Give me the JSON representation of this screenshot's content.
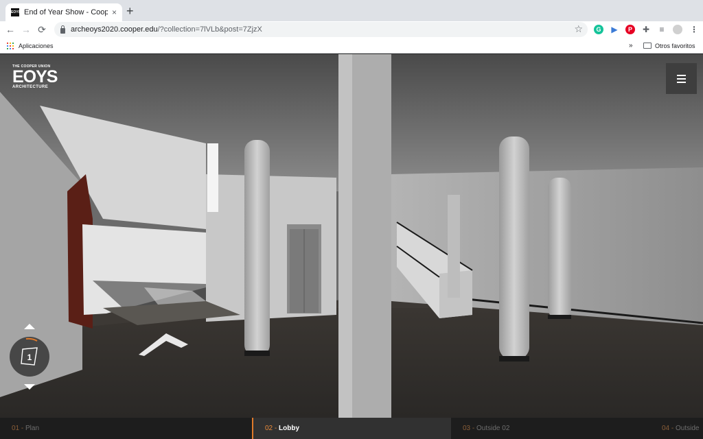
{
  "browser": {
    "tab": {
      "favicon_text": "EOYS",
      "title": "End of Year Show - Cooper Union",
      "close": "×"
    },
    "new_tab": "+",
    "nav": {
      "back": "←",
      "forward": "→",
      "reload": "⟳"
    },
    "url": {
      "host": "archeoys2020.cooper.edu",
      "path": "/?collection=7lVLb&post=7ZjzX"
    },
    "star": "☆",
    "extensions": [
      {
        "name": "grammarly-icon",
        "letter": "G",
        "color": "#15c39a"
      },
      {
        "name": "extension-flag-icon",
        "letter": "▶",
        "color": "#3b7bd6"
      },
      {
        "name": "pinterest-icon",
        "letter": "P",
        "color": "#e60023"
      },
      {
        "name": "puzzle-icon",
        "letter": "✚",
        "color": "#5f6368"
      },
      {
        "name": "media-queue-icon",
        "letter": "≡",
        "color": "#5f6368"
      },
      {
        "name": "profile-avatar-icon",
        "letter": "",
        "color": "#d0d0d0"
      },
      {
        "name": "more-menu-icon",
        "letter": "⋮",
        "color": "#5f6368"
      }
    ],
    "bookmarks": {
      "apps_label": "Aplicaciones",
      "overflow": "»",
      "other_label": "Otros favoritos"
    }
  },
  "site": {
    "logo": {
      "top": "THE COOPER UNION",
      "main": "EOYS",
      "bottom": "ARCHITECTURE"
    },
    "floor": {
      "current": "1"
    },
    "scenes": [
      {
        "num": "01 -",
        "label": "Plan",
        "active": false
      },
      {
        "num": "02 -",
        "label": "Lobby",
        "active": true
      },
      {
        "num": "03 -",
        "label": "Outside 02",
        "active": false
      },
      {
        "num": "04 -",
        "label": "Outside",
        "active": false
      }
    ]
  }
}
